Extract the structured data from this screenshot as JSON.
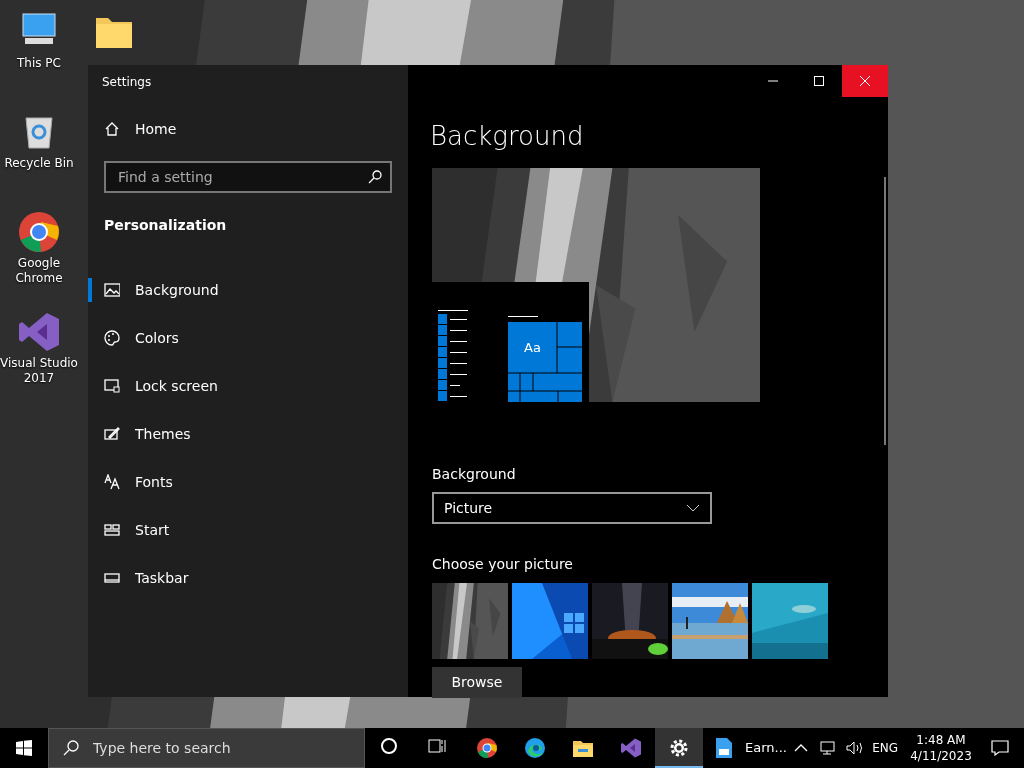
{
  "desktop_icons": [
    {
      "kind": "pc",
      "label": "This PC"
    },
    {
      "kind": "recycle",
      "label": "Recycle Bin"
    },
    {
      "kind": "chrome",
      "label": "Google Chrome"
    },
    {
      "kind": "vs",
      "label": "Visual Studio 2017"
    },
    {
      "kind": "folder"
    }
  ],
  "window": {
    "title": "Settings"
  },
  "sidebar": {
    "home": "Home",
    "search": {
      "placeholder": "Find a setting"
    },
    "section": "Personalization",
    "items": [
      {
        "kind": "background",
        "label": "Background",
        "selected": true
      },
      {
        "kind": "colors",
        "label": "Colors",
        "selected": false
      },
      {
        "kind": "lock",
        "label": "Lock screen",
        "selected": false
      },
      {
        "kind": "themes",
        "label": "Themes",
        "selected": false
      },
      {
        "kind": "fonts",
        "label": "Fonts",
        "selected": false
      },
      {
        "kind": "start",
        "label": "Start",
        "selected": false
      },
      {
        "kind": "taskbar",
        "label": "Taskbar",
        "selected": false
      }
    ]
  },
  "content": {
    "title": "Background",
    "preview_tile": "Aa",
    "background_label": "Background",
    "background_value": "Picture",
    "choose_label": "Choose your picture",
    "pictures": [
      {
        "kind": "rock"
      },
      {
        "kind": "windows"
      },
      {
        "kind": "night"
      },
      {
        "kind": "beach"
      },
      {
        "kind": "underwater"
      }
    ],
    "browse": "Browse"
  },
  "taskbar": {
    "search": {
      "placeholder": "Type here to search"
    },
    "apps": [
      {
        "kind": "cortana",
        "active": false
      },
      {
        "kind": "taskview",
        "active": false
      },
      {
        "kind": "chrome",
        "active": false
      },
      {
        "kind": "edge",
        "active": false
      },
      {
        "kind": "explorer",
        "active": false
      },
      {
        "kind": "vs",
        "active": false
      },
      {
        "kind": "settings",
        "active": true
      },
      {
        "kind": "doc",
        "label": "Earn...",
        "active": false
      }
    ],
    "language": "ENG",
    "time": "1:48 AM",
    "date": "4/11/2023"
  }
}
